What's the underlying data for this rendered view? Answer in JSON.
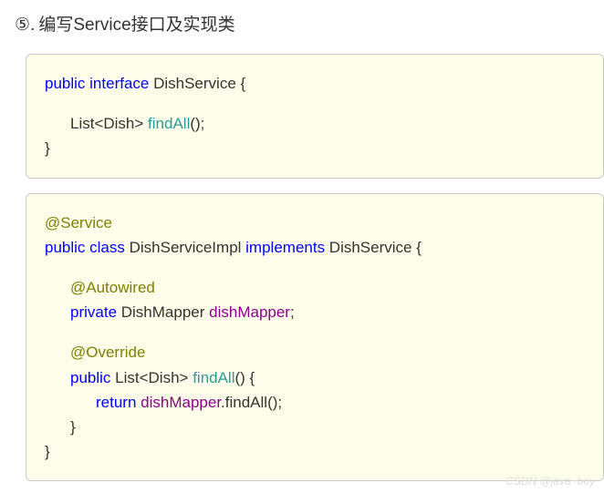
{
  "heading": {
    "number": "⑤.",
    "title": "编写Service接口及实现类"
  },
  "code1": {
    "tokens": {
      "public": "public",
      "interface": "interface",
      "ifaceName": " DishService {",
      "listOpen": "List<Dish> ",
      "findAll": "findAll",
      "findAllArgs": "();",
      "close": "}"
    }
  },
  "code2": {
    "tokens": {
      "service": "@Service",
      "public": "public",
      "class": "class",
      "className": " DishServiceImpl ",
      "implements": "implements",
      "ifaceName": " DishService {",
      "autowired": "@Autowired",
      "private": "private",
      "mapperType": " DishMapper ",
      "mapperField": "dishMapper",
      "semi": ";",
      "override": "@Override",
      "public2": "public",
      "retType": " List<Dish> ",
      "findAll": "findAll",
      "findAllArgs": "() {",
      "return": "return",
      "sp": " ",
      "mapperCall": "dishMapper",
      "callTail": ".findAll();",
      "closeInner": "}",
      "closeOuter": "}"
    }
  },
  "watermark": "CSDN @java~boy"
}
